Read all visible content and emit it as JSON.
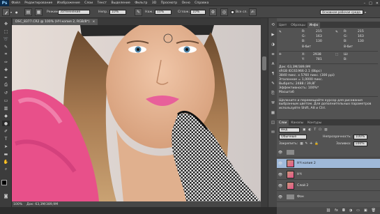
{
  "menubar": {
    "logo": "Ps",
    "items": [
      "Файл",
      "Редактирование",
      "Изображение",
      "Слои",
      "Текст",
      "Выделение",
      "Фильтр",
      "3D",
      "Просмотр",
      "Окно",
      "Справка"
    ]
  },
  "window_controls": {
    "minimize": "–",
    "maximize": "□",
    "close": "✕"
  },
  "options_bar": {
    "mode_label": "Режим:",
    "mode_value": "Затемнение",
    "opacity_label": "Непр.:",
    "opacity_value": "10%",
    "flow_label": "Наж.:",
    "flow_value": "10%",
    "smooth_label": "Сглаж.:",
    "smooth_value": "10%",
    "all_layers_label": "Все сл.",
    "workspace_value": "Основная рабочая среда"
  },
  "document": {
    "tab_title": "DSC_8377.CR2 @ 100% (НЧ копия 2, RGB/8*)",
    "tab_close": "×",
    "zoom": "100%",
    "status": "Док: 63,3М/389,9М"
  },
  "info_panel": {
    "tabs": [
      "Цвет",
      "Образцы",
      "Инфо"
    ],
    "active_tab": "Инфо",
    "r_label": "R:",
    "g_label": "G:",
    "b_label": "B:",
    "r_value": "215",
    "g_value": "163",
    "b_value": "130",
    "r2_value": "215",
    "g2_value": "163",
    "b2_value": "130",
    "bit_label": "8-бит",
    "x_label": "X:",
    "y_label": "Y:",
    "x_value": "2938",
    "y_value": "781",
    "w_label": "Ш:",
    "h_label": "В:",
    "doc_info": "Док: 63,3М/389,9М",
    "profile": "sRGB IEC61966-2.1 (8bpc)",
    "size_px": "3840 пикс. x 5760 пикс. (300 ppi)",
    "scale": "Эталонное = 1,0000 пикс.",
    "saved": "Выбрать: 2488 / 39,8Г",
    "efficiency": "Эффективность: 100%*",
    "timing": "Масштаб",
    "hint": "Щелкните и перемещайте курсор для рисования выбранным цветом. Для дополнительных параметров используйте Shift, Alt и Ctrl."
  },
  "layers_panel": {
    "tabs": [
      "Слои",
      "Каналы",
      "Контуры"
    ],
    "active_tab": "Слои",
    "kind_value": "Вид",
    "blend_value": "Обычные",
    "opacity_label": "Непрозрачность:",
    "opacity_value": "100%",
    "lock_label": "Закрепить:",
    "fill_label": "Заливка:",
    "fill_value": "100%",
    "layers": [
      {
        "name": "",
        "type": "folder",
        "selected": false
      },
      {
        "name": "НЧ копия 2",
        "type": "photo",
        "selected": true
      },
      {
        "name": "НЧ",
        "type": "photo",
        "selected": false
      },
      {
        "name": "Слой 2",
        "type": "photo",
        "selected": false
      },
      {
        "name": "Фон",
        "type": "folder",
        "selected": false
      }
    ],
    "footer_icons": [
      "link-icon",
      "fx-icon",
      "mask-icon",
      "adjustment-icon",
      "folder-icon",
      "new-layer-icon",
      "trash-icon"
    ]
  },
  "colors": {
    "panel_bg": "#535353",
    "selection": "#9fb9d9",
    "background_skin": "#d8a888",
    "pink_fur": "#e8508a"
  }
}
